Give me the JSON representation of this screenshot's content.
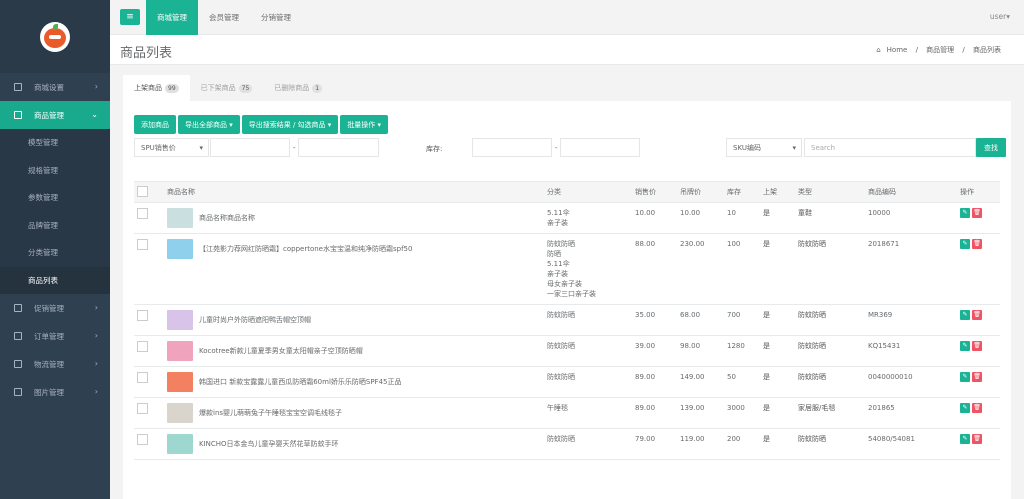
{
  "sidebar": {
    "items": [
      {
        "label": "商城设置",
        "icon": "list-icon",
        "arrow": "›"
      },
      {
        "label": "商品管理",
        "icon": "cart-icon",
        "arrow": "⌄",
        "active": true
      },
      {
        "label": "促销管理",
        "icon": "tag-icon",
        "arrow": "›"
      },
      {
        "label": "订单管理",
        "icon": "order-icon",
        "arrow": "›"
      },
      {
        "label": "物流管理",
        "icon": "truck-icon",
        "arrow": "›"
      },
      {
        "label": "图片管理",
        "icon": "image-icon",
        "arrow": "›"
      }
    ],
    "subitems": [
      "模型管理",
      "规格管理",
      "参数管理",
      "品牌管理",
      "分类管理",
      "商品列表"
    ]
  },
  "topbar": {
    "menu_icon": "≡",
    "tabs": [
      "商城管理",
      "会员管理",
      "分销管理"
    ],
    "user": "user▾"
  },
  "header": {
    "title": "商品列表",
    "breadcrumb": [
      "Home",
      "商品管理",
      "商品列表"
    ],
    "home_icon": "home-icon",
    "sep": "/"
  },
  "tabs": [
    {
      "label": "上架商品",
      "count": "99"
    },
    {
      "label": "已下架商品",
      "count": "75"
    },
    {
      "label": "已删除商品",
      "count": "1"
    }
  ],
  "toolbar": {
    "add": "添加商品",
    "export_all": "导出全部商品 ▾",
    "export_search": "导出搜索结果 / 勾选商品 ▾",
    "batch": "批量操作 ▾"
  },
  "filters": {
    "price_select": "SPU销售价",
    "dash": "-",
    "stock_label": "库存:",
    "sku_select": "SKU编码",
    "search_placeholder": "Search",
    "search_button": "查找",
    "caret": "▾"
  },
  "table": {
    "headers": [
      "商品名称",
      "分类",
      "销售价",
      "吊牌价",
      "库存",
      "上架",
      "类型",
      "商品编码",
      "操作"
    ],
    "rows": [
      {
        "name": "商品名称商品名称",
        "category": [
          "5.11伞",
          "亲子装"
        ],
        "price": "10.00",
        "tag_price": "10.00",
        "stock": "10",
        "on": "是",
        "type": "童鞋",
        "code": "10000",
        "thumb": "#c9dfe0"
      },
      {
        "name": "【江苑影力荐网红防晒霜】coppertone水宝宝温和纯净防晒霜spf50",
        "category": [
          "防蚊防晒",
          "防晒",
          "5.11伞",
          "亲子装",
          "母女亲子装",
          "一家三口亲子装"
        ],
        "price": "88.00",
        "tag_price": "230.00",
        "stock": "100",
        "on": "是",
        "type": "防蚊防晒",
        "code": "2018671",
        "thumb": "#8fd0ec"
      },
      {
        "name": "儿童时尚户外防晒遮阳鸭舌帽空顶帽",
        "category": [
          "防蚊防晒"
        ],
        "price": "35.00",
        "tag_price": "68.00",
        "stock": "700",
        "on": "是",
        "type": "防蚊防晒",
        "code": "MR369",
        "thumb": "#d7c4e8"
      },
      {
        "name": "Kocotree新款儿童夏季男女童太阳帽亲子空顶防晒帽",
        "category": [
          "防蚊防晒"
        ],
        "price": "39.00",
        "tag_price": "98.00",
        "stock": "1280",
        "on": "是",
        "type": "防蚊防晒",
        "code": "KQ15431",
        "thumb": "#f0a3bd"
      },
      {
        "name": "韩国进口 新款宝露露儿童西瓜防晒霜60ml娇乐乐防晒SPF45正品",
        "category": [
          "防蚊防晒"
        ],
        "price": "89.00",
        "tag_price": "149.00",
        "stock": "50",
        "on": "是",
        "type": "防蚊防晒",
        "code": "0040000010",
        "thumb": "#f48062"
      },
      {
        "name": "爆款ins婴儿萌萌兔子午睡毯宝宝空调毛线毯子",
        "category": [
          "午睡毯"
        ],
        "price": "89.00",
        "tag_price": "139.00",
        "stock": "3000",
        "on": "是",
        "type": "家居服/毛毯",
        "code": "201865",
        "thumb": "#d9d4cc"
      },
      {
        "name": "KINCHO日本金鸟儿童孕婴天然花草防蚊手环",
        "category": [
          "防蚊防晒"
        ],
        "price": "79.00",
        "tag_price": "119.00",
        "stock": "200",
        "on": "是",
        "type": "防蚊防晒",
        "code": "54080/54081",
        "thumb": "#9ed7d0"
      }
    ]
  }
}
